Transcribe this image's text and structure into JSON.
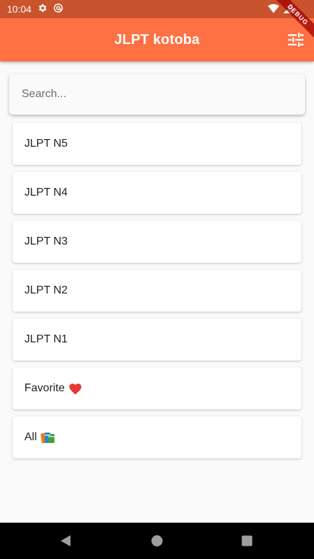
{
  "status_bar": {
    "time": "10:04"
  },
  "debug_banner": {
    "label": "DEBUG"
  },
  "app_bar": {
    "title": "JLPT kotoba",
    "accent_color": "#ff7043",
    "status_color": "#c8532c"
  },
  "search": {
    "placeholder": "Search...",
    "value": ""
  },
  "levels": [
    {
      "label": "JLPT N5",
      "emoji": ""
    },
    {
      "label": "JLPT N4",
      "emoji": ""
    },
    {
      "label": "JLPT N3",
      "emoji": ""
    },
    {
      "label": "JLPT N2",
      "emoji": ""
    },
    {
      "label": "JLPT N1",
      "emoji": ""
    },
    {
      "label": "Favorite",
      "emoji": "heart-icon"
    },
    {
      "label": "All",
      "emoji": "books-icon"
    }
  ],
  "navigation": {
    "back": "back-icon",
    "home": "home-icon",
    "recents": "recents-icon"
  }
}
